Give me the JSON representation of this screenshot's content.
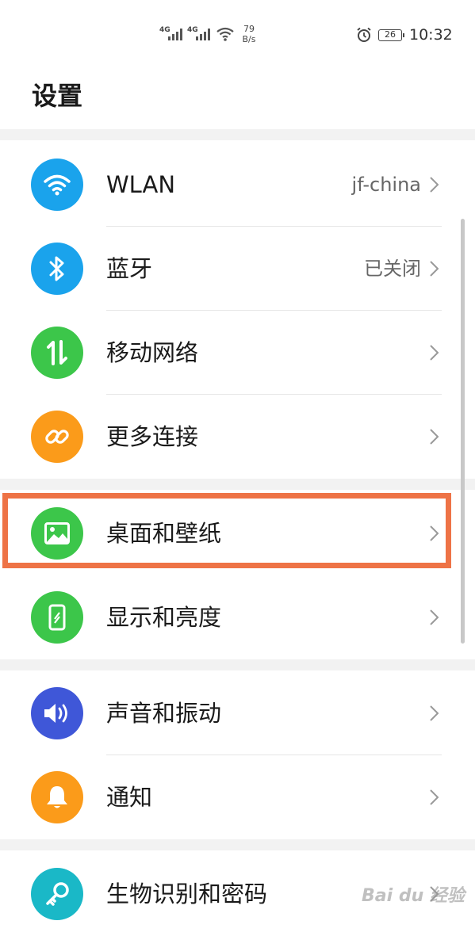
{
  "status_bar": {
    "signal1": "4G",
    "signal2": "4G",
    "net_speed_value": "79",
    "net_speed_unit": "B/s",
    "battery": "26",
    "time": "10:32"
  },
  "header": {
    "title": "设置"
  },
  "settings": [
    {
      "label": "WLAN",
      "value": "jf-china",
      "icon": "wifi-icon",
      "color": "#1aa3ec"
    },
    {
      "label": "蓝牙",
      "value": "已关闭",
      "icon": "bluetooth-icon",
      "color": "#1aa3ec"
    },
    {
      "label": "移动网络",
      "value": "",
      "icon": "mobile-data-icon",
      "color": "#3cc64a"
    },
    {
      "label": "更多连接",
      "value": "",
      "icon": "link-icon",
      "color": "#fb9b1a"
    },
    {
      "label": "桌面和壁纸",
      "value": "",
      "icon": "image-icon",
      "color": "#3cc64a"
    },
    {
      "label": "显示和亮度",
      "value": "",
      "icon": "phone-brightness-icon",
      "color": "#3cc64a"
    },
    {
      "label": "声音和振动",
      "value": "",
      "icon": "speaker-icon",
      "color": "#3f57d8"
    },
    {
      "label": "通知",
      "value": "",
      "icon": "bell-icon",
      "color": "#fb9b1a"
    },
    {
      "label": "生物识别和密码",
      "value": "",
      "icon": "key-icon",
      "color": "#1ab8c7"
    }
  ],
  "accent": {
    "highlight": "#ee7346"
  },
  "watermark": "Bai du 经验"
}
